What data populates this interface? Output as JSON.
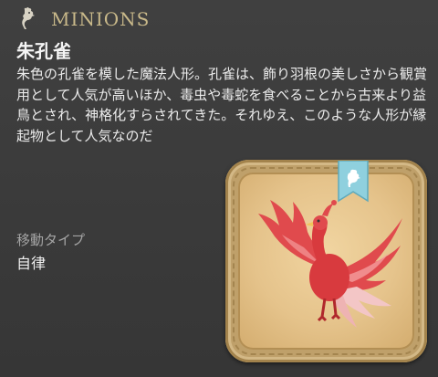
{
  "header": {
    "title": "MINIONS",
    "icon": "chocobo-icon"
  },
  "minion": {
    "name": "朱孔雀",
    "description": "朱色の孔雀を模した魔法人形。孔雀は、飾り羽根の美しさから観賞用として人気が高いほか、毒虫や毒蛇を食べることから古来より益鳥とされ、神格化すらされてきた。それゆえ、このような人形が縁起物として人気なのだ",
    "movement_label": "移動タイプ",
    "movement_value": "自律"
  },
  "colors": {
    "title": "#c9b98a",
    "frame": "#bfa06a",
    "ribbon": "#7fc6d6",
    "bird": "#e2484a"
  }
}
